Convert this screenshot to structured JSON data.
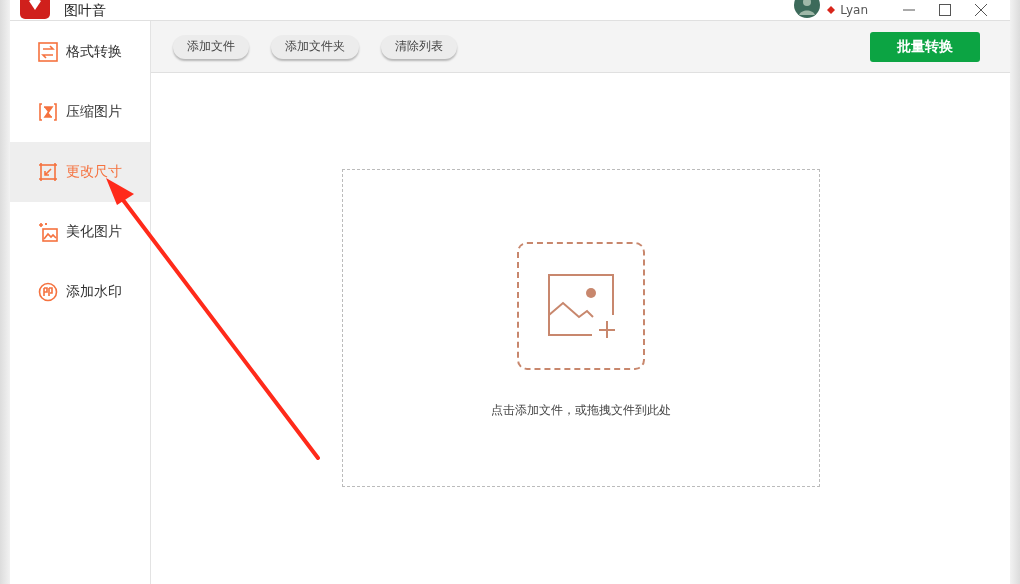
{
  "window": {
    "title": "图叶音",
    "user": "Lyan"
  },
  "sidebar": {
    "items": [
      {
        "label": "格式转换",
        "kind": "convert",
        "selected": false
      },
      {
        "label": "压缩图片",
        "kind": "compress",
        "selected": false
      },
      {
        "label": "更改尺寸",
        "kind": "resize",
        "selected": true
      },
      {
        "label": "美化图片",
        "kind": "beautify",
        "selected": false
      },
      {
        "label": "添加水印",
        "kind": "watermark",
        "selected": false
      }
    ]
  },
  "toolbar": {
    "buttons": [
      "添加文件",
      "添加文件夹",
      "清除列表"
    ],
    "primary": "批量转换"
  },
  "dropzone": {
    "hint": "点击添加文件，或拖拽文件到此处"
  },
  "annotation": {
    "kind": "arrow"
  }
}
